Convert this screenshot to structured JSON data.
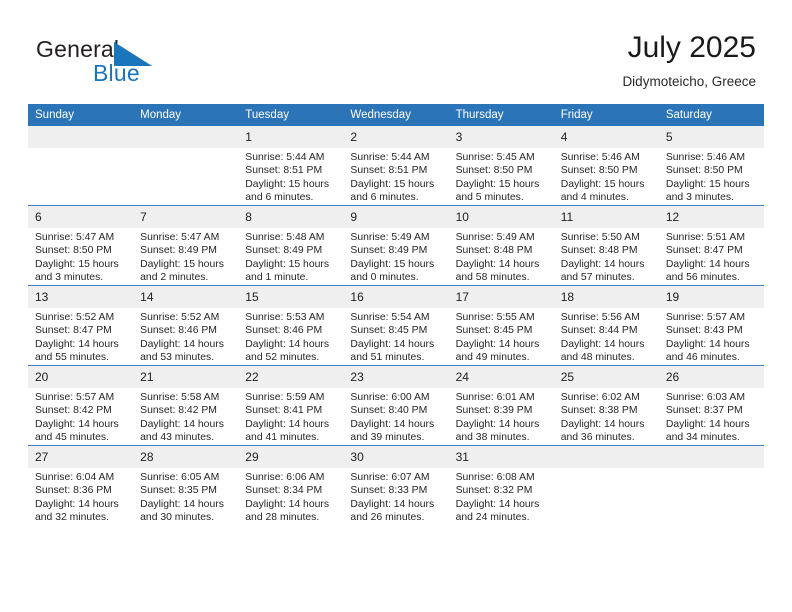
{
  "brand": {
    "name_top": "General",
    "name_bottom": "Blue",
    "triangle_color": "#1b75bb"
  },
  "header": {
    "title": "July 2025",
    "location": "Didymoteicho, Greece"
  },
  "theme": {
    "header_blue": "#2b74b8",
    "row_divider": "#4a7ebb",
    "daynum_band": "#efefef",
    "text": "#262626"
  },
  "weekday_headers": [
    "Sunday",
    "Monday",
    "Tuesday",
    "Wednesday",
    "Thursday",
    "Friday",
    "Saturday"
  ],
  "weeks": [
    [
      {
        "day": "",
        "sunrise": "",
        "sunset": "",
        "daylight1": "",
        "daylight2": ""
      },
      {
        "day": "",
        "sunrise": "",
        "sunset": "",
        "daylight1": "",
        "daylight2": ""
      },
      {
        "day": "1",
        "sunrise": "Sunrise: 5:44 AM",
        "sunset": "Sunset: 8:51 PM",
        "daylight1": "Daylight: 15 hours",
        "daylight2": "and 6 minutes."
      },
      {
        "day": "2",
        "sunrise": "Sunrise: 5:44 AM",
        "sunset": "Sunset: 8:51 PM",
        "daylight1": "Daylight: 15 hours",
        "daylight2": "and 6 minutes."
      },
      {
        "day": "3",
        "sunrise": "Sunrise: 5:45 AM",
        "sunset": "Sunset: 8:50 PM",
        "daylight1": "Daylight: 15 hours",
        "daylight2": "and 5 minutes."
      },
      {
        "day": "4",
        "sunrise": "Sunrise: 5:46 AM",
        "sunset": "Sunset: 8:50 PM",
        "daylight1": "Daylight: 15 hours",
        "daylight2": "and 4 minutes."
      },
      {
        "day": "5",
        "sunrise": "Sunrise: 5:46 AM",
        "sunset": "Sunset: 8:50 PM",
        "daylight1": "Daylight: 15 hours",
        "daylight2": "and 3 minutes."
      }
    ],
    [
      {
        "day": "6",
        "sunrise": "Sunrise: 5:47 AM",
        "sunset": "Sunset: 8:50 PM",
        "daylight1": "Daylight: 15 hours",
        "daylight2": "and 3 minutes."
      },
      {
        "day": "7",
        "sunrise": "Sunrise: 5:47 AM",
        "sunset": "Sunset: 8:49 PM",
        "daylight1": "Daylight: 15 hours",
        "daylight2": "and 2 minutes."
      },
      {
        "day": "8",
        "sunrise": "Sunrise: 5:48 AM",
        "sunset": "Sunset: 8:49 PM",
        "daylight1": "Daylight: 15 hours",
        "daylight2": "and 1 minute."
      },
      {
        "day": "9",
        "sunrise": "Sunrise: 5:49 AM",
        "sunset": "Sunset: 8:49 PM",
        "daylight1": "Daylight: 15 hours",
        "daylight2": "and 0 minutes."
      },
      {
        "day": "10",
        "sunrise": "Sunrise: 5:49 AM",
        "sunset": "Sunset: 8:48 PM",
        "daylight1": "Daylight: 14 hours",
        "daylight2": "and 58 minutes."
      },
      {
        "day": "11",
        "sunrise": "Sunrise: 5:50 AM",
        "sunset": "Sunset: 8:48 PM",
        "daylight1": "Daylight: 14 hours",
        "daylight2": "and 57 minutes."
      },
      {
        "day": "12",
        "sunrise": "Sunrise: 5:51 AM",
        "sunset": "Sunset: 8:47 PM",
        "daylight1": "Daylight: 14 hours",
        "daylight2": "and 56 minutes."
      }
    ],
    [
      {
        "day": "13",
        "sunrise": "Sunrise: 5:52 AM",
        "sunset": "Sunset: 8:47 PM",
        "daylight1": "Daylight: 14 hours",
        "daylight2": "and 55 minutes."
      },
      {
        "day": "14",
        "sunrise": "Sunrise: 5:52 AM",
        "sunset": "Sunset: 8:46 PM",
        "daylight1": "Daylight: 14 hours",
        "daylight2": "and 53 minutes."
      },
      {
        "day": "15",
        "sunrise": "Sunrise: 5:53 AM",
        "sunset": "Sunset: 8:46 PM",
        "daylight1": "Daylight: 14 hours",
        "daylight2": "and 52 minutes."
      },
      {
        "day": "16",
        "sunrise": "Sunrise: 5:54 AM",
        "sunset": "Sunset: 8:45 PM",
        "daylight1": "Daylight: 14 hours",
        "daylight2": "and 51 minutes."
      },
      {
        "day": "17",
        "sunrise": "Sunrise: 5:55 AM",
        "sunset": "Sunset: 8:45 PM",
        "daylight1": "Daylight: 14 hours",
        "daylight2": "and 49 minutes."
      },
      {
        "day": "18",
        "sunrise": "Sunrise: 5:56 AM",
        "sunset": "Sunset: 8:44 PM",
        "daylight1": "Daylight: 14 hours",
        "daylight2": "and 48 minutes."
      },
      {
        "day": "19",
        "sunrise": "Sunrise: 5:57 AM",
        "sunset": "Sunset: 8:43 PM",
        "daylight1": "Daylight: 14 hours",
        "daylight2": "and 46 minutes."
      }
    ],
    [
      {
        "day": "20",
        "sunrise": "Sunrise: 5:57 AM",
        "sunset": "Sunset: 8:42 PM",
        "daylight1": "Daylight: 14 hours",
        "daylight2": "and 45 minutes."
      },
      {
        "day": "21",
        "sunrise": "Sunrise: 5:58 AM",
        "sunset": "Sunset: 8:42 PM",
        "daylight1": "Daylight: 14 hours",
        "daylight2": "and 43 minutes."
      },
      {
        "day": "22",
        "sunrise": "Sunrise: 5:59 AM",
        "sunset": "Sunset: 8:41 PM",
        "daylight1": "Daylight: 14 hours",
        "daylight2": "and 41 minutes."
      },
      {
        "day": "23",
        "sunrise": "Sunrise: 6:00 AM",
        "sunset": "Sunset: 8:40 PM",
        "daylight1": "Daylight: 14 hours",
        "daylight2": "and 39 minutes."
      },
      {
        "day": "24",
        "sunrise": "Sunrise: 6:01 AM",
        "sunset": "Sunset: 8:39 PM",
        "daylight1": "Daylight: 14 hours",
        "daylight2": "and 38 minutes."
      },
      {
        "day": "25",
        "sunrise": "Sunrise: 6:02 AM",
        "sunset": "Sunset: 8:38 PM",
        "daylight1": "Daylight: 14 hours",
        "daylight2": "and 36 minutes."
      },
      {
        "day": "26",
        "sunrise": "Sunrise: 6:03 AM",
        "sunset": "Sunset: 8:37 PM",
        "daylight1": "Daylight: 14 hours",
        "daylight2": "and 34 minutes."
      }
    ],
    [
      {
        "day": "27",
        "sunrise": "Sunrise: 6:04 AM",
        "sunset": "Sunset: 8:36 PM",
        "daylight1": "Daylight: 14 hours",
        "daylight2": "and 32 minutes."
      },
      {
        "day": "28",
        "sunrise": "Sunrise: 6:05 AM",
        "sunset": "Sunset: 8:35 PM",
        "daylight1": "Daylight: 14 hours",
        "daylight2": "and 30 minutes."
      },
      {
        "day": "29",
        "sunrise": "Sunrise: 6:06 AM",
        "sunset": "Sunset: 8:34 PM",
        "daylight1": "Daylight: 14 hours",
        "daylight2": "and 28 minutes."
      },
      {
        "day": "30",
        "sunrise": "Sunrise: 6:07 AM",
        "sunset": "Sunset: 8:33 PM",
        "daylight1": "Daylight: 14 hours",
        "daylight2": "and 26 minutes."
      },
      {
        "day": "31",
        "sunrise": "Sunrise: 6:08 AM",
        "sunset": "Sunset: 8:32 PM",
        "daylight1": "Daylight: 14 hours",
        "daylight2": "and 24 minutes."
      },
      {
        "day": "",
        "sunrise": "",
        "sunset": "",
        "daylight1": "",
        "daylight2": ""
      },
      {
        "day": "",
        "sunrise": "",
        "sunset": "",
        "daylight1": "",
        "daylight2": ""
      }
    ]
  ]
}
